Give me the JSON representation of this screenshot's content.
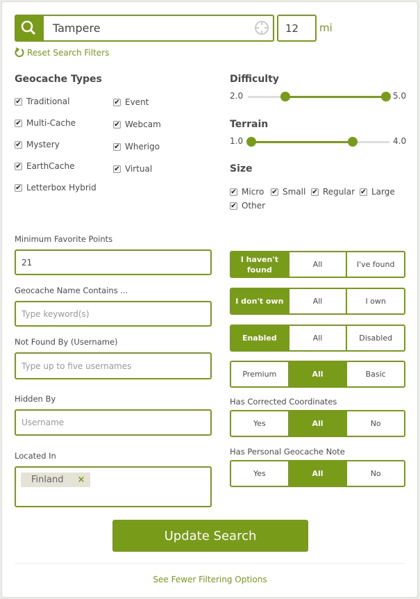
{
  "search": {
    "location": "Tampere",
    "radius": "12",
    "unit": "mi",
    "reset_label": "Reset Search Filters"
  },
  "types": {
    "title": "Geocache Types",
    "items": [
      {
        "label": "Traditional",
        "checked": true
      },
      {
        "label": "Multi-Cache",
        "checked": true
      },
      {
        "label": "Mystery",
        "checked": true
      },
      {
        "label": "EarthCache",
        "checked": true
      },
      {
        "label": "Letterbox Hybrid",
        "checked": true
      },
      {
        "label": "Event",
        "checked": true
      },
      {
        "label": "Webcam",
        "checked": true
      },
      {
        "label": "Wherigo",
        "checked": true
      },
      {
        "label": "Virtual",
        "checked": true
      }
    ]
  },
  "difficulty": {
    "title": "Difficulty",
    "min_label": "2.0",
    "max_label": "5.0",
    "low": 2.0,
    "high": 5.0,
    "range": [
      1,
      5
    ]
  },
  "terrain": {
    "title": "Terrain",
    "min_label": "1.0",
    "max_label": "4.0",
    "low": 1.0,
    "high": 4.0,
    "range": [
      1,
      5
    ]
  },
  "size": {
    "title": "Size",
    "items": [
      {
        "label": "Micro",
        "checked": true
      },
      {
        "label": "Small",
        "checked": true
      },
      {
        "label": "Regular",
        "checked": true
      },
      {
        "label": "Large",
        "checked": true
      },
      {
        "label": "Other",
        "checked": true
      }
    ]
  },
  "fields": {
    "fav_label": "Minimum Favorite Points",
    "fav_value": "21",
    "name_label": "Geocache Name Contains ...",
    "name_placeholder": "Type keyword(s)",
    "notfound_label": "Not Found By (Username)",
    "notfound_placeholder": "Type up to five usernames",
    "hidden_label": "Hidden By",
    "hidden_placeholder": "Username",
    "located_label": "Located In",
    "located_tag": "Finland"
  },
  "toggles": {
    "found": [
      "I haven't found",
      "All",
      "I've found"
    ],
    "own": [
      "I don't own",
      "All",
      "I own"
    ],
    "enabled": [
      "Enabled",
      "All",
      "Disabled"
    ],
    "premium": [
      "Premium",
      "All",
      "Basic"
    ],
    "corrected_label": "Has Corrected Coordinates",
    "corrected": [
      "Yes",
      "All",
      "No"
    ],
    "note_label": "Has Personal Geocache Note",
    "note": [
      "Yes",
      "All",
      "No"
    ]
  },
  "actions": {
    "update": "Update Search",
    "fewer": "See Fewer Filtering Options"
  },
  "colors": {
    "accent": "#789b1a"
  }
}
